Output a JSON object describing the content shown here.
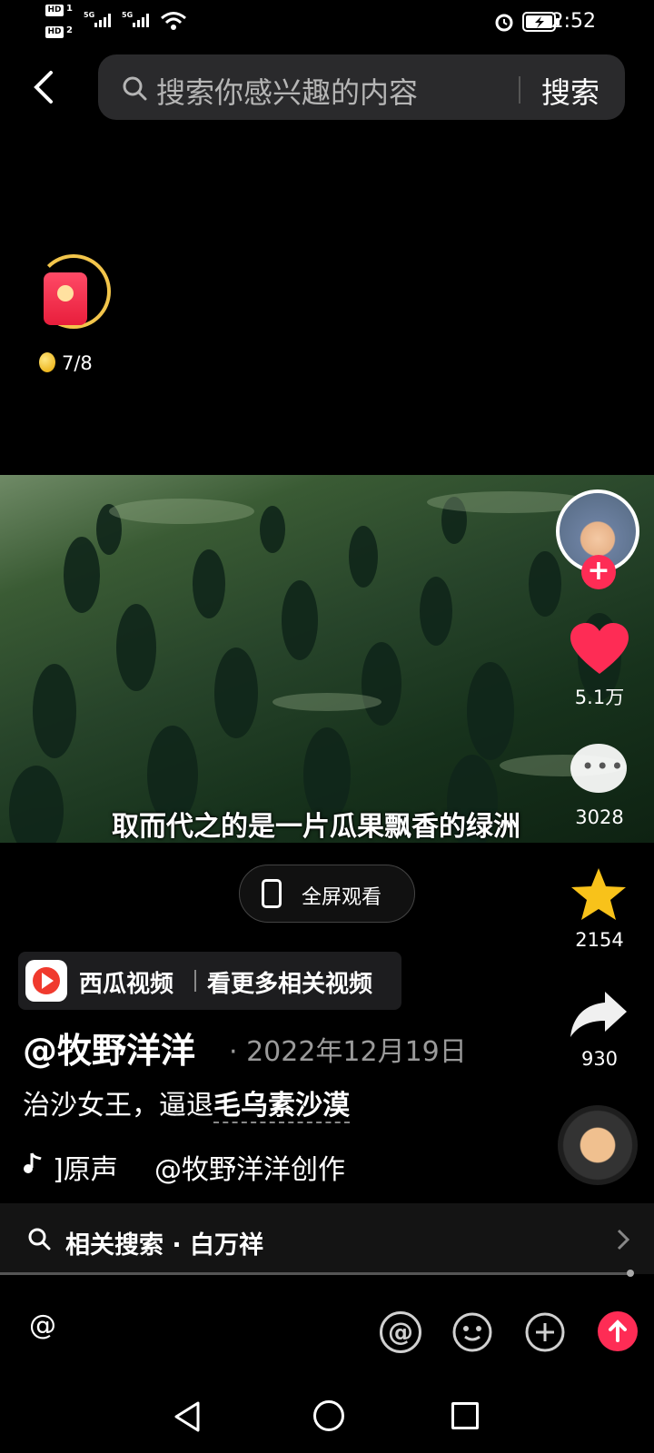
{
  "status_bar": {
    "hd1": "HD",
    "hd1_num": "1",
    "hd2": "HD",
    "hd2_num": "2",
    "signal1": "5G",
    "signal2": "5G",
    "time": "2:52"
  },
  "search": {
    "placeholder": "搜索你感兴趣的内容",
    "button": "搜索"
  },
  "reward": {
    "count": "7/8"
  },
  "video": {
    "subtitle": "取而代之的是一片瓜果飘香的绿洲",
    "fullscreen_label": "全屏观看"
  },
  "actions": {
    "likes": "5.1万",
    "comments": "3028",
    "favorites": "2154",
    "shares": "930"
  },
  "xigua": {
    "name": "西瓜视频",
    "more": "看更多相关视频"
  },
  "post": {
    "author": "@牧野洋洋",
    "date": "· 2022年12月19日",
    "desc_prefix": "治沙女王，逼退",
    "desc_link": "毛乌素沙漠",
    "music": "]原声",
    "music_author": "@牧野洋洋创作"
  },
  "related": {
    "label": "相关搜索 · 白万祥"
  },
  "comment_bar": {
    "placeholder": "@"
  },
  "colors": {
    "accent": "#fe2c55",
    "background": "#000000",
    "star": "#f8c21a"
  }
}
